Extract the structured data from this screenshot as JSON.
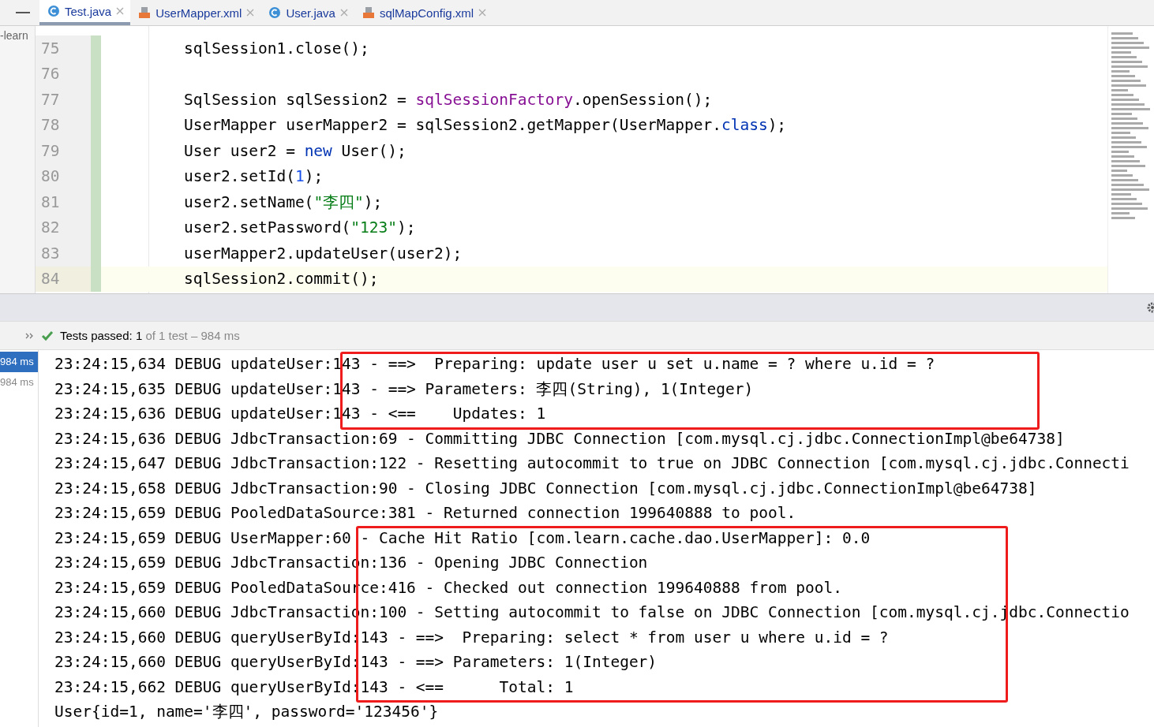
{
  "tabs": [
    {
      "label": "Test.java",
      "kind": "class",
      "selected": true
    },
    {
      "label": "UserMapper.xml",
      "kind": "xml",
      "selected": false
    },
    {
      "label": "User.java",
      "kind": "class",
      "selected": false
    },
    {
      "label": "sqlMapConfig.xml",
      "kind": "xml",
      "selected": false
    }
  ],
  "project_label": "-learn",
  "editor": {
    "lines": [
      {
        "number": "75",
        "current": false,
        "tokens": [
          {
            "text": "sqlSession1.close();",
            "kind": "plain"
          }
        ]
      },
      {
        "number": "76",
        "current": false
      },
      {
        "number": "77",
        "current": false,
        "tokens": [
          {
            "text": "SqlSession sqlSession2 = ",
            "kind": "plain"
          },
          {
            "text": "sqlSessionFactory",
            "kind": "field"
          },
          {
            "text": ".openSession();",
            "kind": "plain"
          }
        ]
      },
      {
        "number": "78",
        "current": false,
        "tokens": [
          {
            "text": "UserMapper userMapper2 = sqlSession2.getMapper(UserMapper.",
            "kind": "plain"
          },
          {
            "text": "class",
            "kind": "keyword"
          },
          {
            "text": ");",
            "kind": "plain"
          }
        ]
      },
      {
        "number": "79",
        "current": false,
        "tokens": [
          {
            "text": "User user2 = ",
            "kind": "plain"
          },
          {
            "text": "new",
            "kind": "keyword"
          },
          {
            "text": " User();",
            "kind": "plain"
          }
        ]
      },
      {
        "number": "80",
        "current": false,
        "tokens": [
          {
            "text": "user2.setId(",
            "kind": "plain"
          },
          {
            "text": "1",
            "kind": "number"
          },
          {
            "text": ");",
            "kind": "plain"
          }
        ]
      },
      {
        "number": "81",
        "current": false,
        "tokens": [
          {
            "text": "user2.setName(",
            "kind": "plain"
          },
          {
            "text": "\"李四\"",
            "kind": "string"
          },
          {
            "text": ");",
            "kind": "plain"
          }
        ]
      },
      {
        "number": "82",
        "current": false,
        "tokens": [
          {
            "text": "user2.setPassword(",
            "kind": "plain"
          },
          {
            "text": "\"123\"",
            "kind": "string"
          },
          {
            "text": ");",
            "kind": "plain"
          }
        ]
      },
      {
        "number": "83",
        "current": false,
        "tokens": [
          {
            "text": "userMapper2.updateUser(user2);",
            "kind": "plain"
          }
        ]
      },
      {
        "number": "84",
        "current": true,
        "tokens": [
          {
            "text": "sqlSession2.commit();",
            "kind": "plain"
          }
        ]
      }
    ]
  },
  "test_status": {
    "label": "Tests passed:",
    "count": "1",
    "detail": "of 1 test – 984 ms"
  },
  "test_tree": [
    {
      "label": "984 ms",
      "selected": true
    },
    {
      "label": "984 ms",
      "selected": false
    }
  ],
  "console": {
    "blocks": [
      {
        "annotated": true,
        "lines": [
          "23:24:15,634 DEBUG updateUser:143 - ==>  Preparing: update user u set u.name = ? where u.id = ?",
          "23:24:15,635 DEBUG updateUser:143 - ==> Parameters: 李四(String), 1(Integer)",
          "23:24:15,636 DEBUG updateUser:143 - <==    Updates: 1"
        ]
      },
      {
        "annotated": false,
        "lines": [
          "23:24:15,636 DEBUG JdbcTransaction:69 - Committing JDBC Connection [com.mysql.cj.jdbc.ConnectionImpl@be64738]",
          "23:24:15,647 DEBUG JdbcTransaction:122 - Resetting autocommit to true on JDBC Connection [com.mysql.cj.jdbc.Connecti",
          "23:24:15,658 DEBUG JdbcTransaction:90 - Closing JDBC Connection [com.mysql.cj.jdbc.ConnectionImpl@be64738]",
          "23:24:15,659 DEBUG PooledDataSource:381 - Returned connection 199640888 to pool."
        ]
      },
      {
        "annotated": true,
        "lines": [
          "23:24:15,659 DEBUG UserMapper:60 - Cache Hit Ratio [com.learn.cache.dao.UserMapper]: 0.0",
          "23:24:15,659 DEBUG JdbcTransaction:136 - Opening JDBC Connection",
          "23:24:15,659 DEBUG PooledDataSource:416 - Checked out connection 199640888 from pool.",
          "23:24:15,660 DEBUG JdbcTransaction:100 - Setting autocommit to false on JDBC Connection [com.mysql.cj.jdbc.Connectio",
          "23:24:15,660 DEBUG queryUserById:143 - ==>  Preparing: select * from user u where u.id = ?",
          "23:24:15,660 DEBUG queryUserById:143 - ==> Parameters: 1(Integer)",
          "23:24:15,662 DEBUG queryUserById:143 - <==      Total: 1"
        ]
      },
      {
        "annotated": false,
        "lines": [
          "User{id=1, name='李四', password='123456'}"
        ]
      }
    ]
  }
}
